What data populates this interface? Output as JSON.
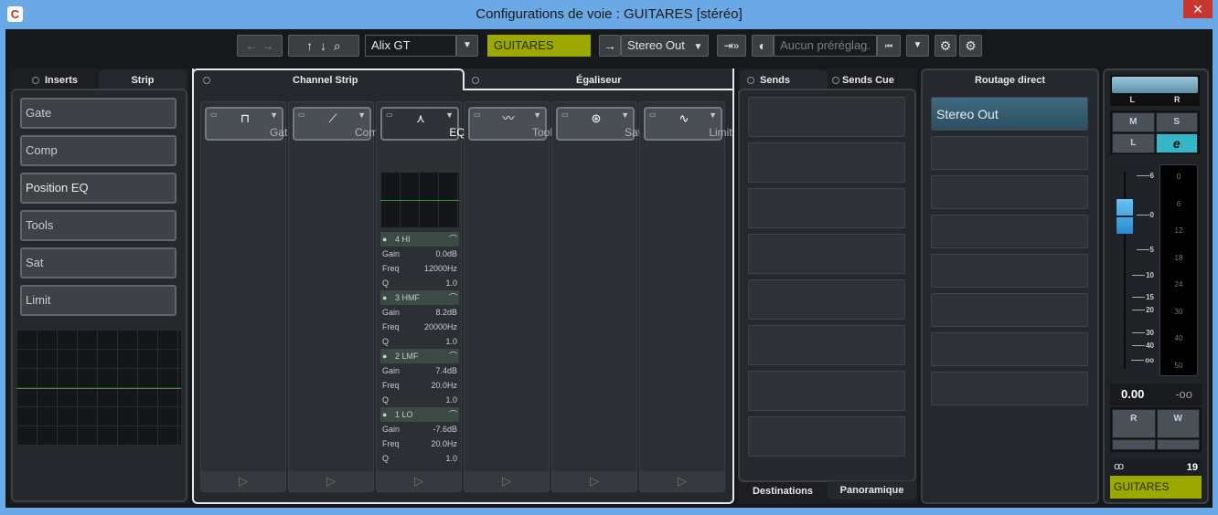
{
  "window": {
    "title": "Configurations de voie : GUITARES [stéréo]",
    "close": "✕",
    "app_icon": "C"
  },
  "toolbar": {
    "back": "←",
    "fwd": "→",
    "up": "↑",
    "down": "↓",
    "search": "⌕",
    "preset_instrument": "Alix GT",
    "channel_name": "GUITARES",
    "output_arrow": "→",
    "output": "Stereo Out",
    "preset_placeholder": "Aucun préréglag.",
    "channel_color": "#9aa800"
  },
  "left_panel": {
    "tabs": [
      "Inserts",
      "Strip"
    ],
    "slots": [
      "Gate",
      "Comp",
      "Position EQ",
      "Tools",
      "Sat",
      "Limit"
    ]
  },
  "center": {
    "tabs": [
      "Channel Strip",
      "Égaliseur"
    ],
    "modules": [
      {
        "name": "Gate",
        "icon": "gate-icon",
        "glyph": "⊓"
      },
      {
        "name": "Comp",
        "icon": "comp-icon",
        "glyph": "⟋"
      },
      {
        "name": "EQ",
        "icon": "eq-icon",
        "glyph": "⋏"
      },
      {
        "name": "Tools",
        "icon": "tools-icon",
        "glyph": "〰"
      },
      {
        "name": "Sat",
        "icon": "sat-icon",
        "glyph": "⊛"
      },
      {
        "name": "Limit",
        "icon": "limit-icon",
        "glyph": "∿"
      }
    ],
    "eq_bands": [
      {
        "name": "4 HI",
        "gain": "0.0dB",
        "freq": "12000Hz",
        "q": "1.0"
      },
      {
        "name": "3 HMF",
        "gain": "8.2dB",
        "freq": "20000Hz",
        "q": "1.0"
      },
      {
        "name": "2 LMF",
        "gain": "7.4dB",
        "freq": "20.0Hz",
        "q": "1.0"
      },
      {
        "name": "1 LO",
        "gain": "-7.6dB",
        "freq": "20.0Hz",
        "q": "1.0"
      }
    ],
    "labels": {
      "gain": "Gain",
      "freq": "Freq",
      "q": "Q"
    }
  },
  "sends": {
    "tabs": [
      "Sends",
      "Sends Cue"
    ],
    "bottom_tabs": [
      "Destinations",
      "Panoramique"
    ]
  },
  "routing": {
    "title": "Routage direct",
    "slots": [
      "Stereo Out"
    ]
  },
  "fader": {
    "pan_l": "L",
    "pan_r": "R",
    "mute": "M",
    "solo": "S",
    "listen": "L",
    "edit": "e",
    "read": "R",
    "write": "W",
    "volume": "0.00",
    "peak": "-oo",
    "channel_number": "19",
    "channel_name": "GUITARES",
    "fader_scale": [
      "6",
      "0",
      "5",
      "10",
      "15",
      "20",
      "30",
      "40",
      "oo"
    ],
    "meter_scale": [
      "0",
      "6",
      "12",
      "18",
      "24",
      "30",
      "40",
      "50"
    ],
    "fader_value_db": 0
  }
}
